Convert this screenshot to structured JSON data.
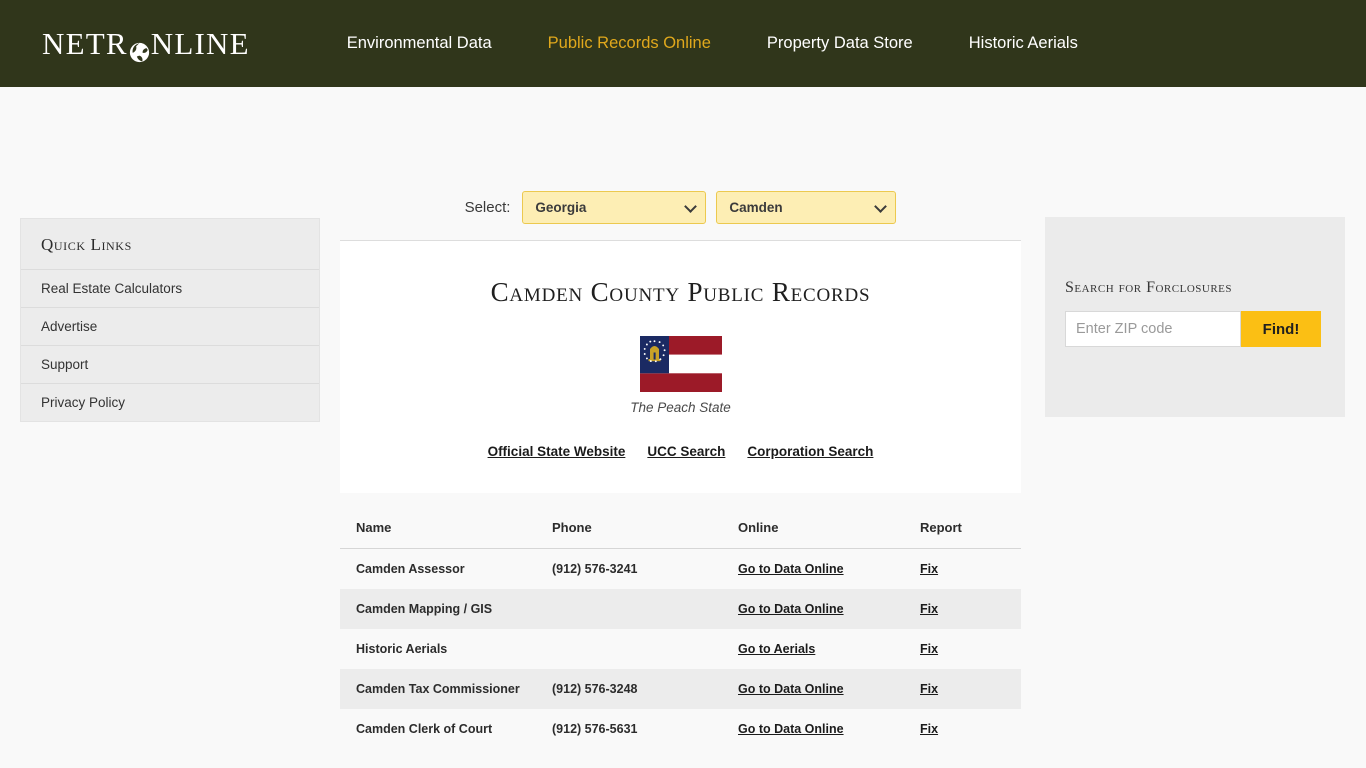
{
  "header": {
    "logo_part_a": "NETR",
    "logo_icon": "globe-icon",
    "logo_part_b": "NLINE",
    "nav": [
      {
        "label": "Environmental Data",
        "active": false
      },
      {
        "label": "Public Records Online",
        "active": true
      },
      {
        "label": "Property Data Store",
        "active": false
      },
      {
        "label": "Historic Aerials",
        "active": false
      }
    ],
    "colors": {
      "bar": "#30361b",
      "active_link": "#e0a81c",
      "link": "#ffffff"
    }
  },
  "sidebar": {
    "title": "Quick Links",
    "items": [
      {
        "label": "Real Estate Calculators"
      },
      {
        "label": "Advertise"
      },
      {
        "label": "Support"
      },
      {
        "label": "Privacy Policy"
      }
    ]
  },
  "selector": {
    "label": "Select:",
    "state_value": "Georgia",
    "county_value": "Camden",
    "accent": "#fdeeb4",
    "border": "#ecc94f"
  },
  "main": {
    "title": "Camden County Public Records",
    "flag": {
      "name": "georgia-state-flag",
      "caption": "The Peach State",
      "canton_color": "#1b2a63",
      "stripe_red": "#9c1a28",
      "stripe_white": "#ffffff",
      "seal_color": "#c9a227"
    },
    "state_links": [
      {
        "label": "Official State Website"
      },
      {
        "label": "UCC Search"
      },
      {
        "label": "Corporation Search"
      }
    ]
  },
  "table": {
    "columns": [
      "Name",
      "Phone",
      "Online",
      "Report"
    ],
    "rows": [
      {
        "name": "Camden Assessor",
        "phone": "(912) 576-3241",
        "online": "Go to Data Online",
        "report": "Fix"
      },
      {
        "name": "Camden Mapping / GIS",
        "phone": "",
        "online": "Go to Data Online",
        "report": "Fix"
      },
      {
        "name": "Historic Aerials",
        "phone": "",
        "online": "Go to Aerials",
        "report": "Fix"
      },
      {
        "name": "Camden Tax Commissioner",
        "phone": "(912) 576-3248",
        "online": "Go to Data Online",
        "report": "Fix"
      },
      {
        "name": "Camden Clerk of Court",
        "phone": "(912) 576-5631",
        "online": "Go to Data Online",
        "report": "Fix"
      }
    ]
  },
  "foreclosure": {
    "title": "Search for Forclosures",
    "zip_placeholder": "Enter ZIP code",
    "zip_value": "",
    "button_label": "Find!",
    "button_color": "#fbbf14"
  }
}
